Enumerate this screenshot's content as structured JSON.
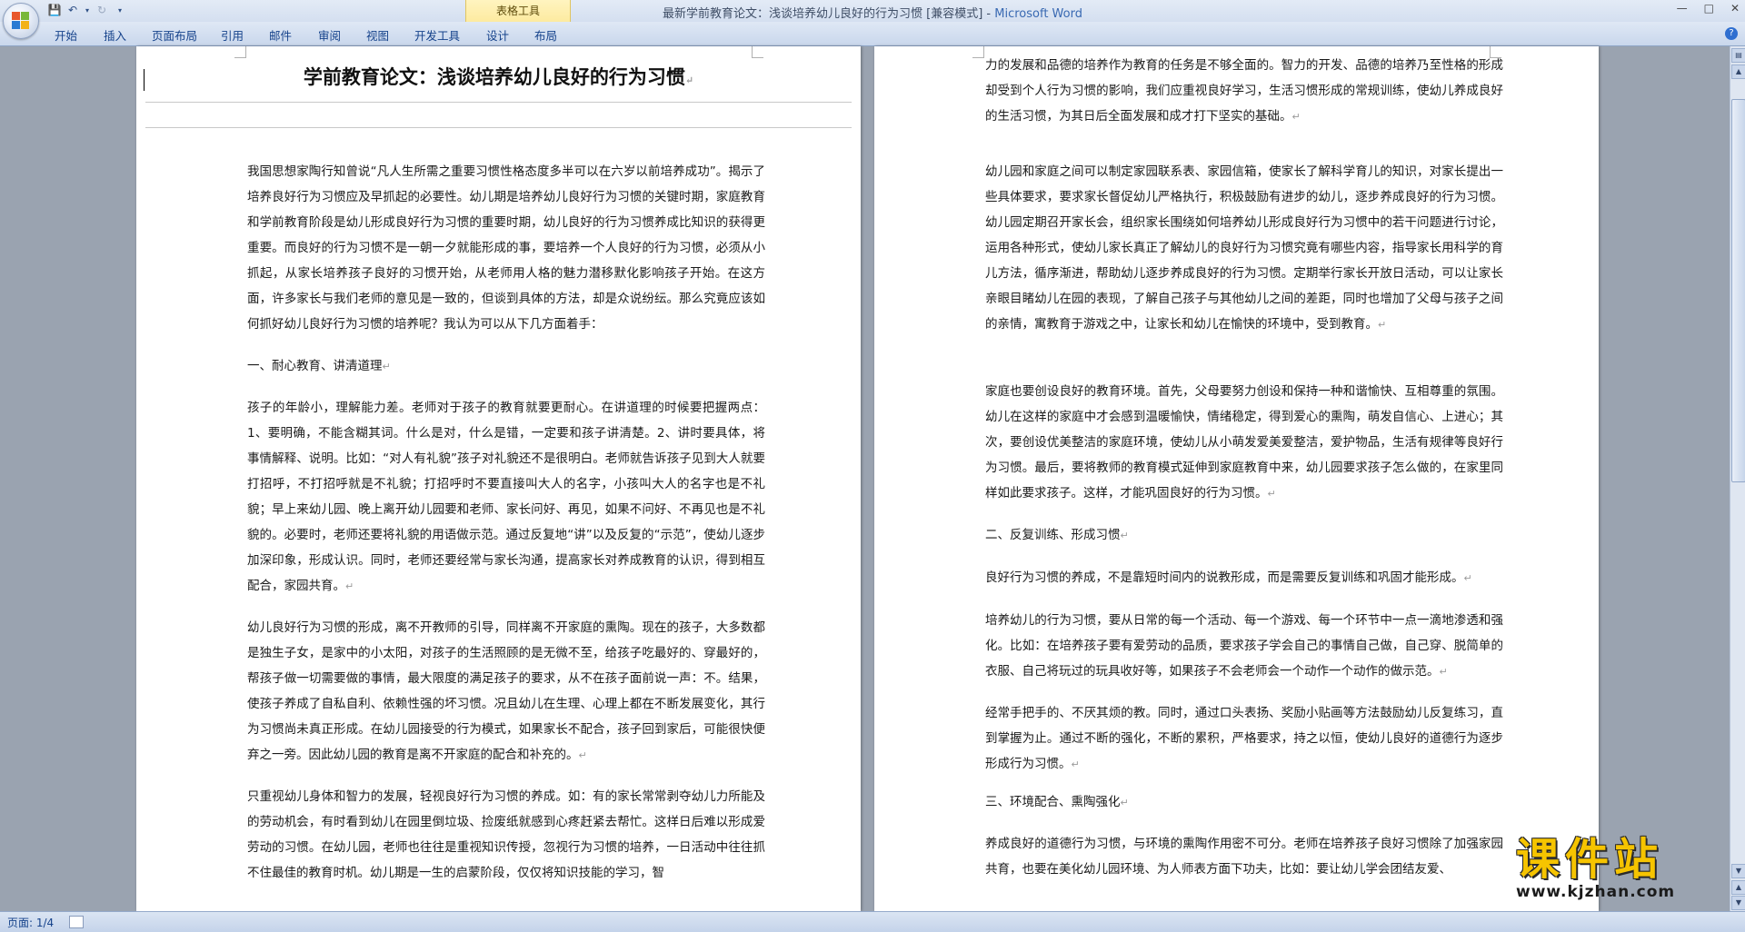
{
  "window": {
    "title": "最新学前教育论文：浅谈培养幼儿良好的行为习惯 [兼容模式] -",
    "app_name": "Microsoft Word",
    "contextual_tab_group": "表格工具"
  },
  "ribbon": {
    "tabs": [
      "开始",
      "插入",
      "页面布局",
      "引用",
      "邮件",
      "审阅",
      "视图",
      "开发工具",
      "设计",
      "布局"
    ]
  },
  "page1": {
    "title": "学前教育论文：浅谈培养幼儿良好的行为习惯",
    "paragraphs": [
      "我国思想家陶行知曾说“凡人生所需之重要习惯性格态度多半可以在六岁以前培养成功”。揭示了培养良好行为习惯应及早抓起的必要性。幼儿期是培养幼儿良好行为习惯的关键时期，家庭教育和学前教育阶段是幼儿形成良好行为习惯的重要时期，幼儿良好的行为习惯养成比知识的获得更重要。而良好的行为习惯不是一朝一夕就能形成的事，要培养一个人良好的行为习惯，必须从小抓起，从家长培养孩子良好的习惯开始，从老师用人格的魅力潜移默化影响孩子开始。在这方面，许多家长与我们老师的意见是一致的，但谈到具体的方法，却是众说纷纭。那么究竟应该如何抓好幼儿良好行为习惯的培养呢？我认为可以从下几方面着手：",
      "一、耐心教育、讲清道理",
      "孩子的年龄小，理解能力差。老师对于孩子的教育就要更耐心。在讲道理的时候要把握两点：1、要明确，不能含糊其词。什么是对，什么是错，一定要和孩子讲清楚。2、讲时要具体，将事情解释、说明。比如：“对人有礼貌”孩子对礼貌还不是很明白。老师就告诉孩子见到大人就要打招呼，不打招呼就是不礼貌；打招呼时不要直接叫大人的名字，小孩叫大人的名字也是不礼貌；早上来幼儿园、晚上离开幼儿园要和老师、家长问好、再见，如果不问好、不再见也是不礼貌的。必要时，老师还要将礼貌的用语做示范。通过反复地“讲”以及反复的“示范”，使幼儿逐步加深印象，形成认识。同时，老师还要经常与家长沟通，提高家长对养成教育的认识，得到相互配合，家园共育。",
      "幼儿良好行为习惯的形成，离不开教师的引导，同样离不开家庭的熏陶。现在的孩子，大多数都是独生子女，是家中的小太阳，对孩子的生活照顾的是无微不至，给孩子吃最好的、穿最好的，帮孩子做一切需要做的事情，最大限度的满足孩子的要求，从不在孩子面前说一声：不。结果，使孩子养成了自私自利、依赖性强的坏习惯。况且幼儿在生理、心理上都在不断发展变化，其行为习惯尚未真正形成。在幼儿园接受的行为模式，如果家长不配合，孩子回到家后，可能很快便弃之一旁。因此幼儿园的教育是离不开家庭的配合和补充的。",
      "只重视幼儿身体和智力的发展，轻视良好行为习惯的养成。如：有的家长常常剥夺幼儿力所能及的劳动机会，有时看到幼儿在园里倒垃圾、捡废纸就感到心疼赶紧去帮忙。这样日后难以形成爱劳动的习惯。在幼儿园，老师也往往是重视知识传授，忽视行为习惯的培养，一日活动中往往抓不住最佳的教育时机。幼儿期是一生的启蒙阶段，仅仅将知识技能的学习，智"
    ]
  },
  "page2": {
    "paragraphs": [
      "力的发展和品德的培养作为教育的任务是不够全面的。智力的开发、品德的培养乃至性格的形成却受到个人行为习惯的影响，我们应重视良好学习，生活习惯形成的常规训练，使幼儿养成良好的生活习惯，为其日后全面发展和成才打下坚实的基础。",
      "幼儿园和家庭之间可以制定家园联系表、家园信箱，使家长了解科学育儿的知识，对家长提出一些具体要求，要求家长督促幼儿严格执行，积极鼓励有进步的幼儿，逐步养成良好的行为习惯。幼儿园定期召开家长会，组织家长围绕如何培养幼儿形成良好行为习惯中的若干问题进行讨论，运用各种形式，使幼儿家长真正了解幼儿的良好行为习惯究竟有哪些内容，指导家长用科学的育儿方法，循序渐进，帮助幼儿逐步养成良好的行为习惯。定期举行家长开放日活动，可以让家长亲眼目睹幼儿在园的表现，了解自己孩子与其他幼儿之间的差距，同时也增加了父母与孩子之间的亲情，寓教育于游戏之中，让家长和幼儿在愉快的环境中，受到教育。",
      "家庭也要创设良好的教育环境。首先，父母要努力创设和保持一种和谐愉快、互相尊重的氛围。幼儿在这样的家庭中才会感到温暖愉快，情绪稳定，得到爱心的熏陶，萌发自信心、上进心；其次，要创设优美整洁的家庭环境，使幼儿从小萌发爱美爱整洁，爱护物品，生活有规律等良好行为习惯。最后，要将教师的教育模式延伸到家庭教育中来，幼儿园要求孩子怎么做的，在家里同样如此要求孩子。这样，才能巩固良好的行为习惯。",
      "二、反复训练、形成习惯",
      "良好行为习惯的养成，不是靠短时间内的说教形成，而是需要反复训练和巩固才能形成。",
      "培养幼儿的行为习惯，要从日常的每一个活动、每一个游戏、每一个环节中一点一滴地渗透和强化。比如：在培养孩子要有爱劳动的品质，要求孩子学会自己的事情自己做，自己穿、脱简单的衣服、自己将玩过的玩具收好等，如果孩子不会老师会一个动作一个动作的做示范。",
      "经常手把手的、不厌其烦的教。同时，通过口头表扬、奖励小贴画等方法鼓励幼儿反复练习，直到掌握为止。通过不断的强化，不断的累积，严格要求，持之以恒，使幼儿良好的道德行为逐步形成行为习惯。",
      "三、环境配合、熏陶强化",
      "养成良好的道德行为习惯，与环境的熏陶作用密不可分。老师在培养孩子良好习惯除了加强家园共育，也要在美化幼儿园环境、为人师表方面下功夫，比如：要让幼儿学会团结友爱、"
    ]
  },
  "status": {
    "page_info": "页面: 1/4"
  },
  "watermark": {
    "text": "课件站",
    "url": "www.kjzhan.com"
  }
}
